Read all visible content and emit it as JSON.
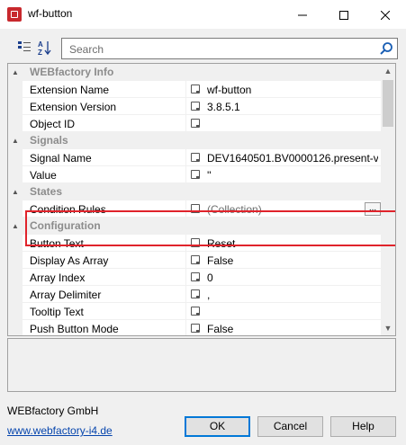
{
  "window": {
    "title": "wf-button",
    "minimize_icon": "minimize-icon",
    "maximize_icon": "maximize-icon",
    "close_icon": "close-icon"
  },
  "toolbar": {
    "categorized_icon": "categorized-view-icon",
    "alphabetical_icon": "alphabetical-sort-icon",
    "alphabetical_label": "AZ"
  },
  "search": {
    "placeholder": "Search",
    "value": ""
  },
  "grid": {
    "categories": [
      {
        "label": "WEBfactory Info",
        "properties": [
          {
            "name": "Extension Name",
            "value": "wf-button"
          },
          {
            "name": "Extension Version",
            "value": "3.8.5.1"
          },
          {
            "name": "Object ID",
            "value": ""
          }
        ]
      },
      {
        "label": "Signals",
        "properties": [
          {
            "name": "Signal Name",
            "value": "DEV1640501.BV0000126.present-v..."
          },
          {
            "name": "Value",
            "value": "''"
          }
        ]
      },
      {
        "label": "States",
        "properties": [
          {
            "name": "Condition Rules",
            "value": "(Collection)",
            "button": "..."
          }
        ]
      },
      {
        "label": "Configuration",
        "properties": [
          {
            "name": "Button Text",
            "value": "Reset"
          },
          {
            "name": "Display As Array",
            "value": "False"
          },
          {
            "name": "Array Index",
            "value": "0"
          },
          {
            "name": "Array Delimiter",
            "value": ","
          },
          {
            "name": "Tooltip Text",
            "value": ""
          },
          {
            "name": "Push Button Mode",
            "value": "False"
          }
        ]
      }
    ]
  },
  "highlight_color": "#e0232b",
  "footer": {
    "company": "WEBfactory GmbH",
    "link": "www.webfactory-i4.de",
    "ok_label": "OK",
    "cancel_label": "Cancel",
    "help_label": "Help"
  }
}
